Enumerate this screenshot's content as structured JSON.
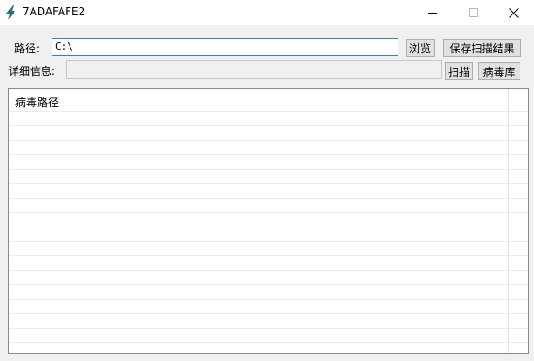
{
  "window": {
    "title": "7ADAFAFE2"
  },
  "form": {
    "path_label": "路径:",
    "path_value": "C:\\",
    "detail_label": "详细信息:",
    "detail_value": ""
  },
  "buttons": {
    "browse": "浏览",
    "save_results": "保存扫描结果",
    "scan": "扫描",
    "virus_db": "病毒库"
  },
  "results": {
    "column_header": "病毒路径",
    "rows": []
  },
  "colors": {
    "accent_border": "#3c7fb1",
    "icon": "#2a6f80"
  },
  "icons": [
    "app-lightning-icon",
    "minimize-icon",
    "maximize-icon",
    "close-icon"
  ]
}
